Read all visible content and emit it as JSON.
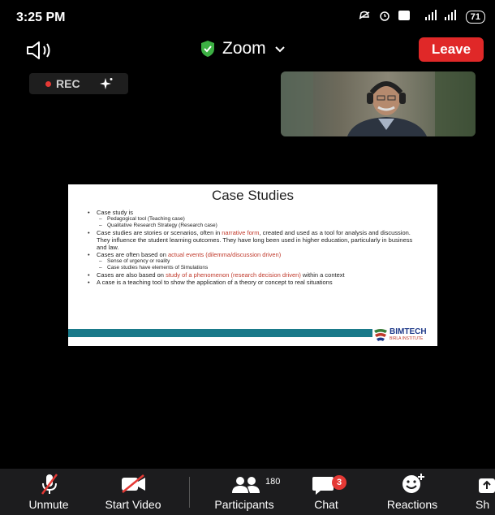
{
  "status_bar": {
    "time": "3:25 PM",
    "signal_label": "4G",
    "battery": "71"
  },
  "header": {
    "app_title": "Zoom",
    "leave_label": "Leave"
  },
  "rec": {
    "label": "REC"
  },
  "slide": {
    "title": "Case Studies",
    "items": [
      {
        "text": "Case study is",
        "subs": [
          "Pedagogical tool (Teaching case)",
          "Qualitative Research Strategy (Research case)"
        ]
      },
      {
        "pre": "Case studies are stories or scenarios, often in ",
        "red": "narrative form",
        "post": ", created and used as a tool for analysis and discussion. They influence the student learning outcomes. They have long been used in higher education, particularly in business and law."
      },
      {
        "pre": "Cases are often based on ",
        "red": "actual events (dilemma/discussion driven)",
        "post": "",
        "subs": [
          "Sense of urgency or reality",
          "Case studies have elements of Simulations"
        ]
      },
      {
        "pre": "Cases are also based on ",
        "red": "study of a phenomenon (research decision driven)",
        "post": " within a context"
      },
      {
        "text": "A case is a teaching tool to show the application of a theory or concept to real situations"
      }
    ],
    "logo_text": "BIMTECH",
    "logo_sub": "BIRLA INSTITUTE"
  },
  "toolbar": {
    "unmute_label": "Unmute",
    "start_video_label": "Start Video",
    "participants_label": "Participants",
    "participants_count": "180",
    "chat_label": "Chat",
    "chat_badge": "3",
    "reactions_label": "Reactions",
    "share_label": "Sh"
  },
  "colors": {
    "leave": "#e02828",
    "badge": "#e53935",
    "shield": "#3cb043",
    "slide_footer": "#1a7a8a"
  }
}
